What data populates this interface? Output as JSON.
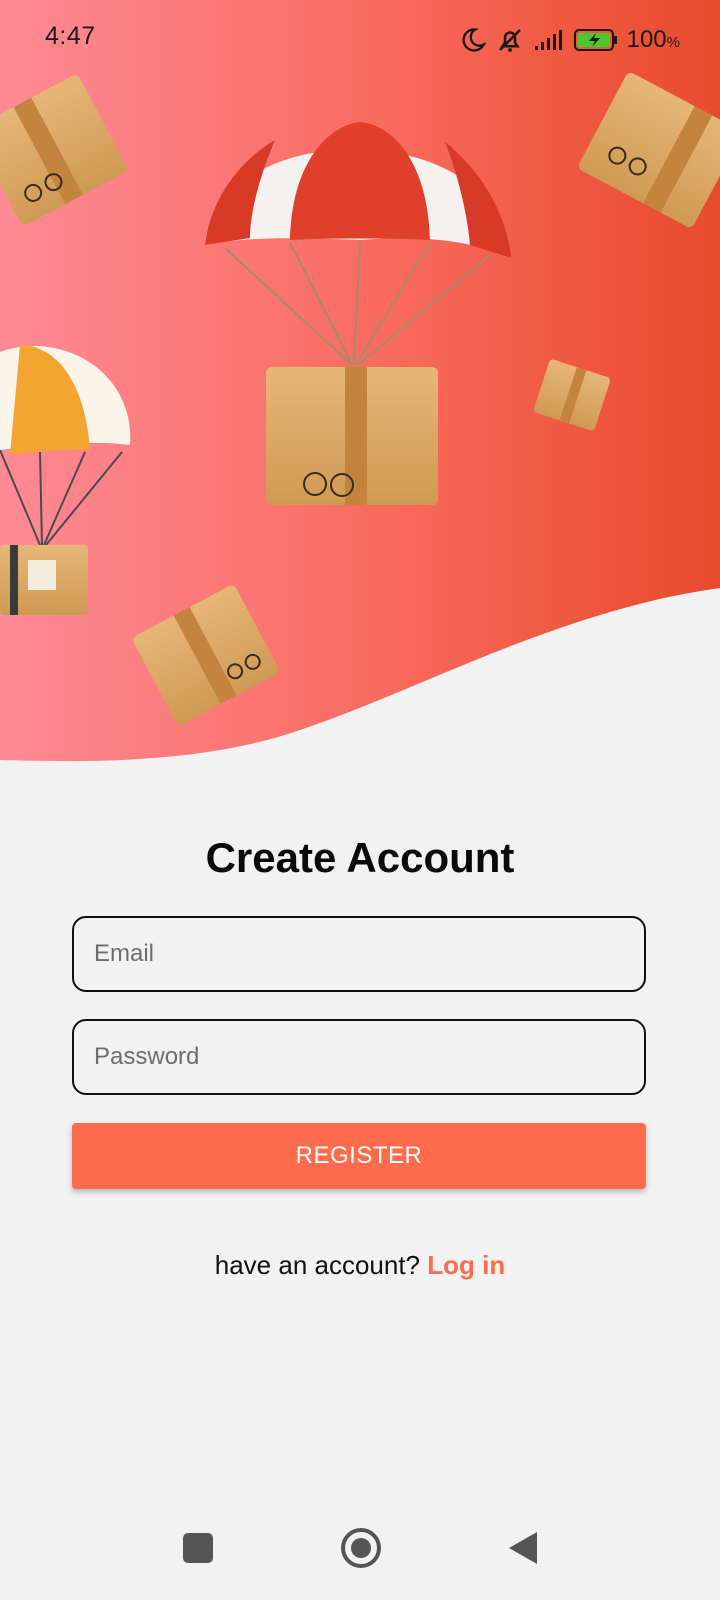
{
  "status_bar": {
    "time": "4:47",
    "battery_percent": "100",
    "battery_unit": "%",
    "icons": [
      "moon-icon",
      "bell-muted-icon",
      "signal-icon",
      "battery-charging-icon"
    ]
  },
  "hero": {
    "gradient_start": "#ff8a96",
    "gradient_end": "#e9502d",
    "illustration": "parachute-delivery-boxes"
  },
  "form": {
    "title": "Create Account",
    "email_placeholder": "Email",
    "email_value": "",
    "password_placeholder": "Password",
    "password_value": "",
    "register_label": "REGISTER",
    "login_prompt": "have an account?",
    "login_link": "Log in"
  },
  "colors": {
    "accent": "#ff6b4d",
    "background": "#f2f2f2"
  },
  "nav_bar": {
    "icons": [
      "recents-square-icon",
      "home-circle-icon",
      "back-triangle-icon"
    ]
  }
}
